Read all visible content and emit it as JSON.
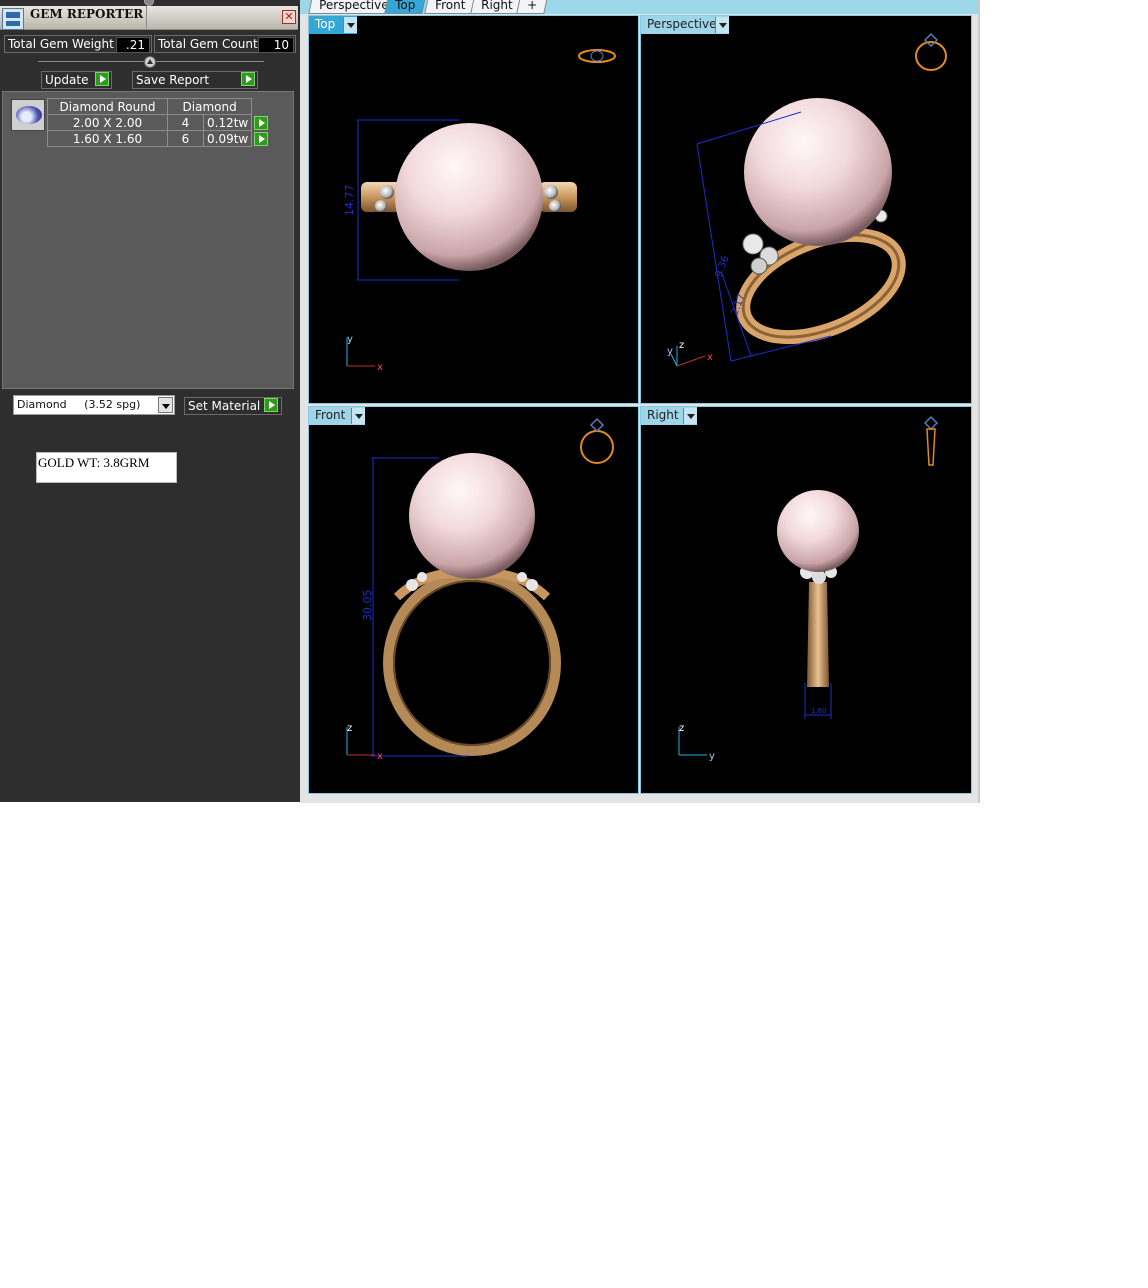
{
  "panel": {
    "title": "GEM REPORTER",
    "close_glyph": "✕",
    "total_weight_label": "Total Gem Weight",
    "total_weight_value": ".21",
    "total_count_label": "Total Gem Count",
    "total_count_value": "10",
    "update_label": "Update",
    "save_report_label": "Save Report"
  },
  "gem_table": {
    "header": [
      "Diamond Round",
      "",
      "Diamond"
    ],
    "rows": [
      {
        "size": "2.00 X 2.00",
        "count": "4",
        "weight": "0.12tw"
      },
      {
        "size": "1.60 X 1.60",
        "count": "6",
        "weight": "0.09tw"
      }
    ]
  },
  "material": {
    "selected": "Diamond     (3.52 spg)",
    "set_label": "Set Material"
  },
  "note": "GOLD WT: 3.8GRM",
  "tabs": [
    {
      "label": "Perspective",
      "active": false
    },
    {
      "label": "Top",
      "active": true
    },
    {
      "label": "Front",
      "active": false
    },
    {
      "label": "Right",
      "active": false
    },
    {
      "label": "+",
      "active": false
    }
  ],
  "viewports": {
    "top": {
      "label": "Top",
      "dimension": "14.77",
      "axes": [
        "y",
        "x"
      ]
    },
    "perspective": {
      "label": "Perspective",
      "dimension": "2.17",
      "dimension2": "9.36",
      "axes": [
        "y",
        "z",
        "x"
      ]
    },
    "front": {
      "label": "Front",
      "dimension": "30.05",
      "axes": [
        "z",
        "x"
      ]
    },
    "right": {
      "label": "Right",
      "dimension": "1.80",
      "axes": [
        "z",
        "y"
      ]
    }
  },
  "icons": [
    "app-icon",
    "close-icon",
    "gem-thumbnail-icon",
    "dropdown-arrow-icon",
    "play-arrow-icon",
    "ring-preview-icon"
  ],
  "colors": {
    "panel_bg": "#2e2e2e",
    "viewport_header_active": "#35a6d6",
    "viewport_header": "#9fd5e8",
    "pearl": "#f0d8dc",
    "gold": "#c9965f",
    "dimension_line": "#1a2fd0",
    "action_button": "#2f9a1e"
  }
}
